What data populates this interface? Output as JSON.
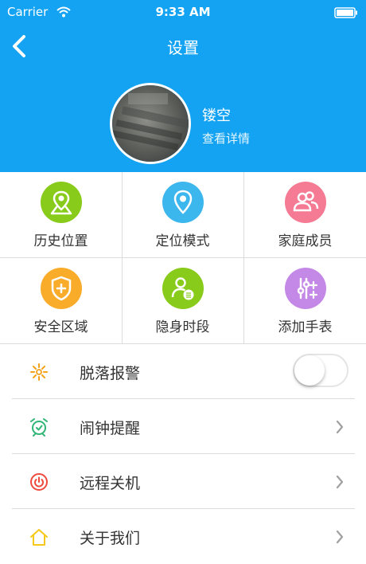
{
  "status_bar": {
    "carrier": "Carrier",
    "time": "9:33 AM"
  },
  "header": {
    "title": "设置"
  },
  "profile": {
    "name": "镂空",
    "link_label": "查看详情"
  },
  "grid": [
    {
      "label": "历史位置",
      "icon": "map-location-icon",
      "color": "#88cb1a"
    },
    {
      "label": "定位模式",
      "icon": "location-pin-icon",
      "color": "#3cb7ee"
    },
    {
      "label": "家庭成员",
      "icon": "family-members-icon",
      "color": "#f57a93"
    },
    {
      "label": "安全区域",
      "icon": "shield-plus-icon",
      "color": "#f8ac2a"
    },
    {
      "label": "隐身时段",
      "icon": "user-hidden-icon",
      "color": "#88cb1a"
    },
    {
      "label": "添加手表",
      "icon": "add-settings-icon",
      "color": "#c488e6"
    }
  ],
  "settings": [
    {
      "label": "脱落报警",
      "icon": "alert-icon",
      "control": "toggle",
      "enabled": false,
      "icon_color": "#f5a21a"
    },
    {
      "label": "闹钟提醒",
      "icon": "alarm-clock-icon",
      "control": "chevron",
      "icon_color": "#2fb575"
    },
    {
      "label": "远程关机",
      "icon": "power-icon",
      "control": "chevron",
      "icon_color": "#f04a3e"
    },
    {
      "label": "关于我们",
      "icon": "home-icon",
      "control": "chevron",
      "icon_color": "#f5c81a"
    }
  ],
  "colors": {
    "header_bg": "#14a3f2",
    "divider": "#dcdcdc"
  }
}
